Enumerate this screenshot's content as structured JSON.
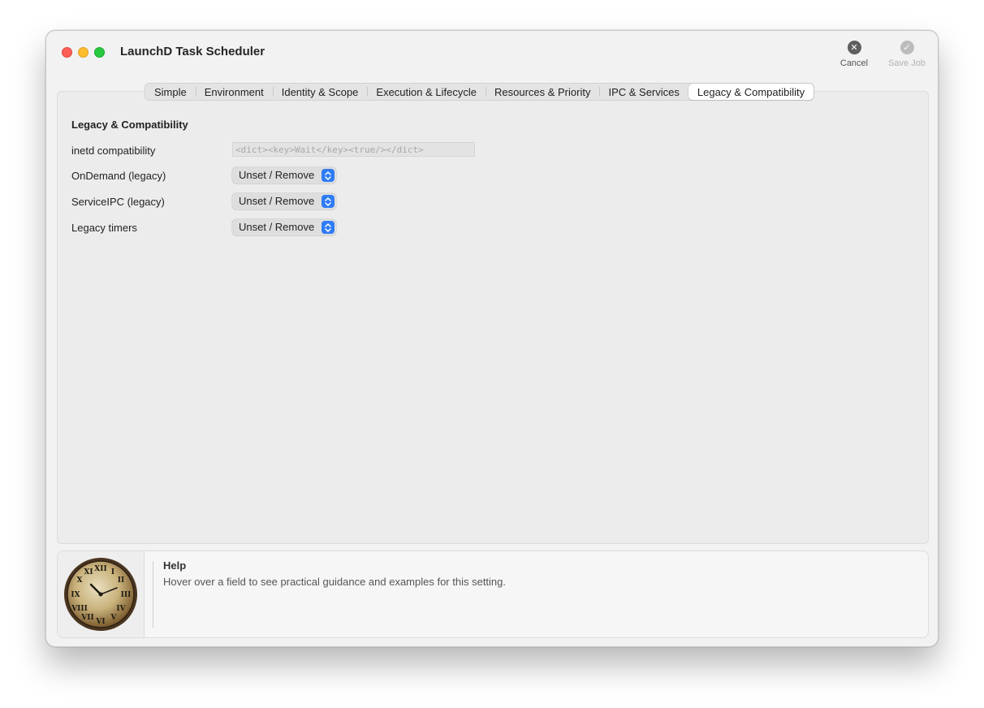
{
  "window": {
    "title": "LaunchD Task Scheduler",
    "cancel_label": "Cancel",
    "save_label": "Save Job"
  },
  "tabs": [
    {
      "label": "Simple"
    },
    {
      "label": "Environment"
    },
    {
      "label": "Identity & Scope"
    },
    {
      "label": "Execution & Lifecycle"
    },
    {
      "label": "Resources & Priority"
    },
    {
      "label": "IPC & Services"
    },
    {
      "label": "Legacy & Compatibility",
      "active": true
    }
  ],
  "section": {
    "title": "Legacy & Compatibility",
    "fields": [
      {
        "label": "inetd compatibility",
        "placeholder": "<dict><key>Wait</key><true/></dict>"
      },
      {
        "label": "OnDemand (legacy)",
        "value": "Unset / Remove"
      },
      {
        "label": "ServiceIPC (legacy)",
        "value": "Unset / Remove"
      },
      {
        "label": "Legacy timers",
        "value": "Unset / Remove"
      }
    ]
  },
  "help": {
    "title": "Help",
    "text": "Hover over a field to see practical guidance and examples for this setting.",
    "image_icon": "wall-clock-icon"
  },
  "colors": {
    "accent": "#2f7cf6",
    "close": "#fe5f57",
    "minimize": "#febc2e",
    "zoom": "#28c840"
  }
}
